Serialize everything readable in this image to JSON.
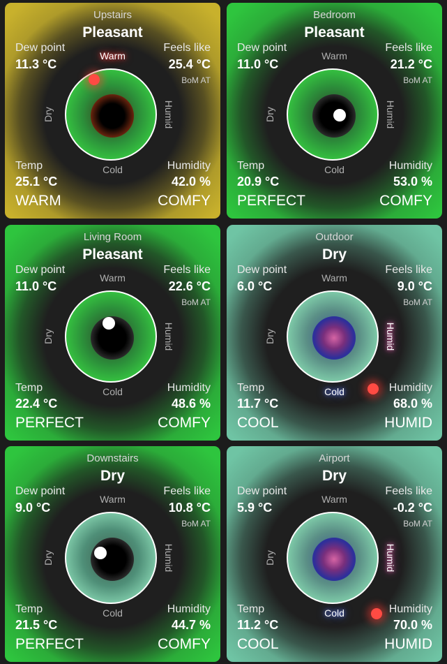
{
  "labels": {
    "dew_point": "Dew point",
    "feels_like": "Feels like",
    "temp": "Temp",
    "humidity": "Humidity",
    "bom": "BoM AT",
    "warm": "Warm",
    "cold": "Cold",
    "dry": "Dry",
    "humid": "Humid"
  },
  "cards": [
    {
      "name": "Upstairs",
      "comfort": "Pleasant",
      "dew_point": "11.3 °C",
      "feels_like": "25.4 °C",
      "temp": "25.1 °C",
      "humidity": "42.0 %",
      "temp_word": "WARM",
      "humidity_word": "COMFY",
      "glow": "#c8b12c",
      "inner": "warm",
      "highlight": "warm"
    },
    {
      "name": "Bedroom",
      "comfort": "Pleasant",
      "dew_point": "11.0 °C",
      "feels_like": "21.2 °C",
      "temp": "20.9 °C",
      "humidity": "53.0 %",
      "temp_word": "PERFECT",
      "humidity_word": "COMFY",
      "glow": "#2ec53e",
      "inner": "neutral",
      "highlight": "none"
    },
    {
      "name": "Living Room",
      "comfort": "Pleasant",
      "dew_point": "11.0 °C",
      "feels_like": "22.6 °C",
      "temp": "22.4 °C",
      "humidity": "48.6 %",
      "temp_word": "PERFECT",
      "humidity_word": "COMFY",
      "glow": "#2ec53e",
      "inner": "neutral",
      "highlight": "none"
    },
    {
      "name": "Outdoor",
      "comfort": "Dry",
      "dew_point": "6.0 °C",
      "feels_like": "9.0 °C",
      "temp": "11.7 °C",
      "humidity": "68.0 %",
      "temp_word": "COOL",
      "humidity_word": "HUMID",
      "glow": "#6fc4a4",
      "inner": "cold",
      "highlight": "cold-humid"
    },
    {
      "name": "Downstairs",
      "comfort": "Dry",
      "dew_point": "9.0 °C",
      "feels_like": "10.8 °C",
      "temp": "21.5 °C",
      "humidity": "44.7 %",
      "temp_word": "PERFECT",
      "humidity_word": "COMFY",
      "glow": "#2ec53e",
      "inner": "neutral",
      "highlight": "none"
    },
    {
      "name": "Airport",
      "comfort": "Dry",
      "dew_point": "5.9 °C",
      "feels_like": "-0.2 °C",
      "temp": "11.2 °C",
      "humidity": "70.0 %",
      "temp_word": "COOL",
      "humidity_word": "HUMID",
      "glow": "#6fc4a4",
      "inner": "cold",
      "highlight": "cold-humid"
    }
  ]
}
